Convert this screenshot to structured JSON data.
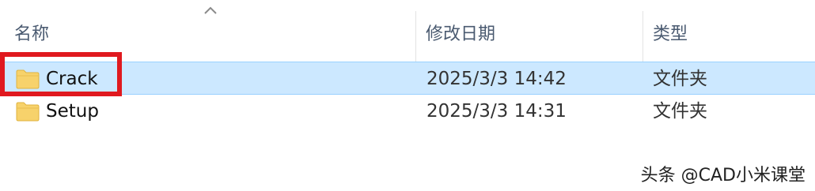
{
  "columns": {
    "name": "名称",
    "date": "修改日期",
    "type": "类型"
  },
  "sort": {
    "column": "name",
    "direction": "ascending"
  },
  "rows": [
    {
      "name": "Crack",
      "date": "2025/3/3 14:42",
      "type": "文件夹",
      "icon": "folder-icon",
      "selected": true
    },
    {
      "name": "Setup",
      "date": "2025/3/3 14:31",
      "type": "文件夹",
      "icon": "folder-icon",
      "selected": false
    }
  ],
  "highlight": {
    "target": "Crack",
    "color": "#e0191f"
  },
  "colors": {
    "selection_bg": "#cce8ff",
    "selection_border": "#99d1ff",
    "folder_yellow": "#f7d26b"
  },
  "watermark": "头条 @CAD小米课堂"
}
